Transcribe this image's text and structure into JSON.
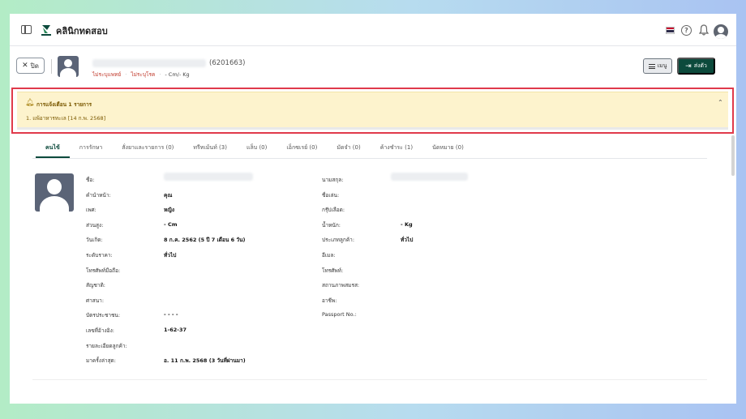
{
  "app": {
    "title": "คลินิกทดสอบ"
  },
  "patient": {
    "hn_text": "(6201663)",
    "tags": [
      "ไม่ระบุแพทย์",
      "ไม่ระบุโรค",
      "- Cm/- Kg"
    ],
    "close_label": "ปิด"
  },
  "actions": {
    "menu_label": "เมนู",
    "send_label": "ส่งตัว"
  },
  "alert": {
    "title": "การแจ้งเตือน 1 รายการ",
    "items": [
      "1. แพ้อาหารทะเล [14 ก.พ. 2568]"
    ]
  },
  "tabs": [
    {
      "label": "คนไข้",
      "active": true
    },
    {
      "label": "การรักษา"
    },
    {
      "label": "สั่งยาและรายการ (0)"
    },
    {
      "label": "ทรีทเม้นท์ (3)"
    },
    {
      "label": "แล็บ (0)"
    },
    {
      "label": "เอ็กซเรย์ (0)"
    },
    {
      "label": "มัดจำ (0)"
    },
    {
      "label": "ค้างชำระ (1)"
    },
    {
      "label": "นัดหมาย (0)"
    }
  ],
  "left_fields": [
    {
      "label": "ชื่อ:",
      "value": ""
    },
    {
      "label": "คำนำหน้า:",
      "value": "คุณ"
    },
    {
      "label": "เพศ:",
      "value": "หญิง"
    },
    {
      "label": "ส่วนสูง:",
      "value": "- Cm"
    },
    {
      "label": "วันเกิด:",
      "value": "8 ก.ค. 2562 (5 ปี 7 เดือน 6 วัน)"
    },
    {
      "label": "ระดับราคา:",
      "value": "ทั่วไป"
    },
    {
      "label": "โทรศัพท์มือถือ:",
      "value": ""
    },
    {
      "label": "สัญชาติ:",
      "value": ""
    },
    {
      "label": "ศาสนา:",
      "value": ""
    },
    {
      "label": "บัตรประชาชน:",
      "value": "- - - -"
    },
    {
      "label": "เลขที่อ้างอิง:",
      "value": "1-62-37"
    },
    {
      "label": "รายละเอียดลูกค้า:",
      "value": ""
    },
    {
      "label": "มาครั้งล่าสุด:",
      "value": "อ. 11 ก.พ. 2568 (3 วันที่ผ่านมา)"
    }
  ],
  "right_fields": [
    {
      "label": "นามสกุล:",
      "value": ""
    },
    {
      "label": "ชื่อเล่น:",
      "value": ""
    },
    {
      "label": "กรุ๊ปเลือด:",
      "value": ""
    },
    {
      "label": "น้ำหนัก:",
      "value": "- Kg"
    },
    {
      "label": "ประเภทลูกค้า:",
      "value": "ทั่วไป"
    },
    {
      "label": "อีเมล:",
      "value": ""
    },
    {
      "label": "โทรศัพท์:",
      "value": ""
    },
    {
      "label": "สถานภาพสมรส:",
      "value": ""
    },
    {
      "label": "อาชีพ:",
      "value": ""
    },
    {
      "label": "Passport No.:",
      "value": ""
    }
  ],
  "colors": {
    "brand": "#0c4a3c",
    "alert_bg": "#fdf3cd",
    "highlight": "#e03a4b"
  }
}
